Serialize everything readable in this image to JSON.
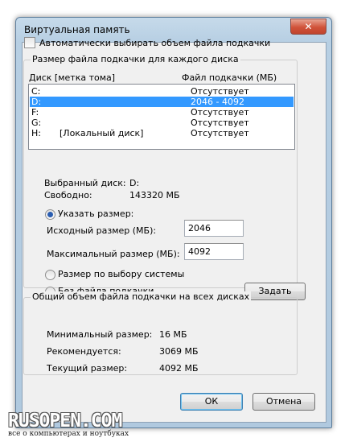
{
  "window": {
    "title": "Виртуальная память",
    "close_symbol": "✕"
  },
  "auto_checkbox": {
    "label": "Автоматически выбирать объем файла подкачки",
    "checked": false
  },
  "size_group": {
    "title": "Размер файла подкачки для каждого диска",
    "col_drive": "Диск [метка тома]",
    "col_file": "Файл подкачки (МБ)",
    "drives": [
      {
        "letter": "C:",
        "label": "",
        "file": "Отсутствует",
        "selected": false
      },
      {
        "letter": "D:",
        "label": "",
        "file": "2046 - 4092",
        "selected": true
      },
      {
        "letter": "F:",
        "label": "",
        "file": "Отсутствует",
        "selected": false
      },
      {
        "letter": "G:",
        "label": "",
        "file": "Отсутствует",
        "selected": false
      },
      {
        "letter": "H:",
        "label": "[Локальный диск]",
        "file": "Отсутствует",
        "selected": false
      }
    ],
    "selected_disk_label": "Выбранный диск:",
    "selected_disk_value": "D:",
    "free_label": "Свободно:",
    "free_value": "143320 МБ",
    "custom_size_label": "Указать размер:",
    "initial_size_label": "Исходный размер (МБ):",
    "initial_size_value": "2046",
    "max_size_label": "Максимальный размер (МБ):",
    "max_size_value": "4092",
    "system_managed_label": "Размер по выбору системы",
    "no_paging_label": "Без файла подкачки",
    "set_button": "Задать",
    "selected_option": "custom"
  },
  "total_group": {
    "title": "Общий объем файла подкачки на всех дисках",
    "min_label": "Минимальный размер:",
    "min_value": "16 МБ",
    "recommended_label": "Рекомендуется:",
    "recommended_value": "3069 МБ",
    "current_label": "Текущий размер:",
    "current_value": "4092 МБ"
  },
  "buttons": {
    "ok": "ОК",
    "cancel": "Отмена"
  },
  "watermark": {
    "logo": "RUSOPEN.COM",
    "tagline": "все о компьютерах и ноутбуках"
  }
}
